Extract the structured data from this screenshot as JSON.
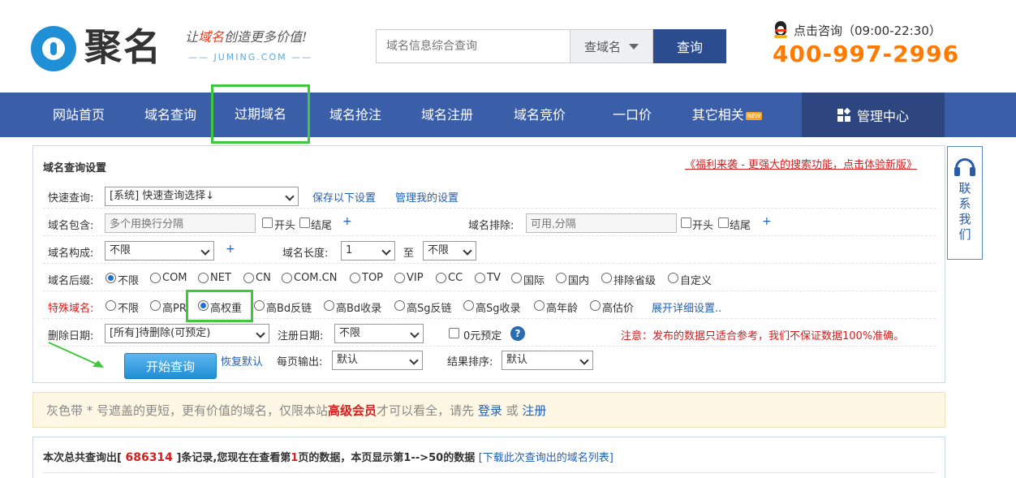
{
  "header": {
    "logo_text": "聚名",
    "slogan_prefix": "让",
    "slogan_red": "域名",
    "slogan_rest": "创造更多价值!",
    "slogan_sub": "—— JUMING.COM ——",
    "search_placeholder": "域名信息综合查询",
    "search_type": "查域名",
    "search_button": "查询",
    "contact_label": "点击咨询（09:00-22:30）",
    "phone": "400-997-2996"
  },
  "nav": {
    "items": [
      "网站首页",
      "域名查询",
      "过期域名",
      "域名抢注",
      "域名注册",
      "域名竞价",
      "一口价",
      "其它相关"
    ],
    "new_badge": "NEW",
    "admin": "管理中心",
    "active_index": 2
  },
  "panel": {
    "title": "域名查询设置",
    "promo_link": "《福利来袭 - 更强大的搜索功能，点击体验新版》",
    "quick_label": "快速查询:",
    "quick_value": "[系统] 快速查询选择↓",
    "save_settings": "保存以下设置",
    "manage_settings": "管理我的设置",
    "contains_label": "域名包含:",
    "contains_placeholder": "多个用换行分隔",
    "begin": "开头",
    "end": "结尾",
    "plus": "+",
    "exclude_label": "域名排除:",
    "exclude_placeholder": "可用,分隔",
    "compose_label": "域名构成:",
    "compose_value": "不限",
    "length_label": "域名长度:",
    "length_min": "1",
    "length_to": "至",
    "length_max": "不限",
    "suffix_label": "域名后缀:",
    "suffixes": [
      "不限",
      "COM",
      "NET",
      "CN",
      "COM.CN",
      "TOP",
      "VIP",
      "CC",
      "TV",
      "国际",
      "国内",
      "排除省级",
      "自定义"
    ],
    "special_label": "特殊域名:",
    "specials": [
      "不限",
      "高PR",
      "高权重",
      "高Bd反链",
      "高Bd收录",
      "高Sg反链",
      "高Sg收录",
      "高年龄",
      "高估价"
    ],
    "special_more": "展开详细设置..",
    "delete_label": "删除日期:",
    "delete_value": "[所有]待删除(可预定)",
    "register_label": "注册日期:",
    "register_value": "不限",
    "zero_reserve": "0元预定",
    "help": "?",
    "warning": "注意：发布的数据只适合参考，我们不保证数据100%准确。",
    "start_button": "开始查询",
    "restore_default": "恢复默认",
    "per_page_label": "每页输出:",
    "per_page_value": "默认",
    "sort_label": "结果排序:",
    "sort_value": "默认"
  },
  "side": {
    "contact": "联系我们"
  },
  "notice": {
    "part1": "灰色带 * 号遮盖的更短，更有价值的域名，仅限本站",
    "vip": "高级会员",
    "part2": "才可以看全，请先 ",
    "login": "登录",
    "or": " 或 ",
    "register": "注册"
  },
  "result": {
    "p1": "本次总共查询出[ ",
    "total": "686314",
    "p2": " ]条记录,您现在在查看第",
    "page": "1",
    "p3": "页的数据，本页显示第1-->50的数据 ",
    "download": "[下载此次查询出的域名列表]"
  },
  "colors": {
    "nav_bg": "#3b5ea8",
    "admin_bg": "#2d4680",
    "phone": "#ff7a00",
    "highlight": "#3ec83e",
    "accent_red": "#d21f1f",
    "link_blue": "#1f5fb5"
  }
}
